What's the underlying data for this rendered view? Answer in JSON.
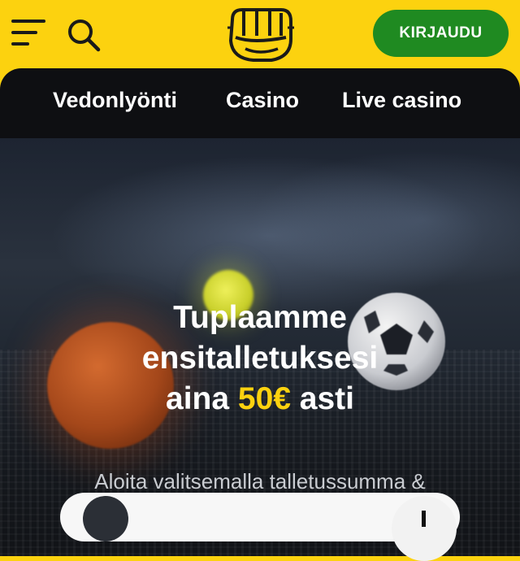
{
  "header": {
    "menu_icon": "hamburger-menu-icon",
    "search_icon": "search-icon",
    "logo_icon": "fist-logo-icon",
    "login_label": "KIRJAUDU"
  },
  "nav": {
    "items": [
      {
        "label": "Vedonlyönti"
      },
      {
        "label": "Casino"
      },
      {
        "label": "Live casino"
      }
    ]
  },
  "hero": {
    "headline_line1": "Tuplaamme",
    "headline_line2": "ensitalletuksesi",
    "headline_pre": "aina ",
    "headline_amount": "50€",
    "headline_post": " asti",
    "subtitle": "Aloita valitsemalla talletussumma & maksutapa"
  },
  "colors": {
    "brand_yellow": "#fcd20f",
    "login_green": "#1f8a21",
    "panel_dark": "#0e0f12"
  }
}
